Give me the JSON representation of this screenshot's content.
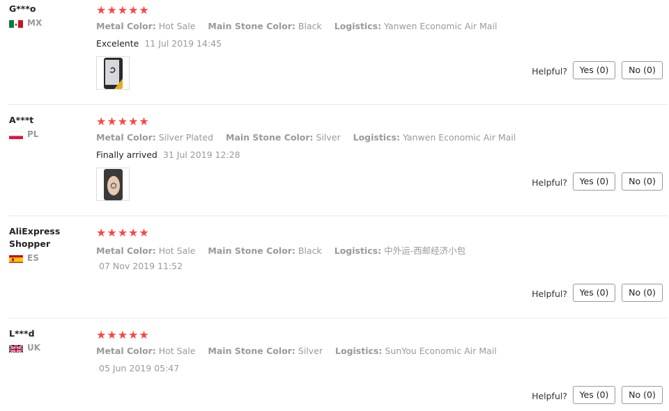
{
  "labels": {
    "metal_color": "Metal Color:",
    "main_stone_color": "Main Stone Color:",
    "logistics": "Logistics:",
    "helpful": "Helpful?",
    "yes": "Yes (0)",
    "no": "No (0)"
  },
  "reviews": [
    {
      "name": "G***o",
      "country": "MX",
      "stars": "★★★★★",
      "rating": 5,
      "metal_color": "Hot Sale",
      "main_stone_color": "Black",
      "logistics": "Yanwen Economic Air Mail",
      "text": "Excelente",
      "date": "11 Jul 2019 14:45",
      "has_photo": true
    },
    {
      "name": "A***t",
      "country": "PL",
      "stars": "★★★★★",
      "rating": 5,
      "metal_color": "Silver Plated",
      "main_stone_color": "Silver",
      "logistics": "Yanwen Economic Air Mail",
      "text": "Finally arrived",
      "date": "31 Jul 2019 12:28",
      "has_photo": true
    },
    {
      "name": "AliExpress Shopper",
      "country": "ES",
      "stars": "★★★★★",
      "rating": 5,
      "metal_color": "Hot Sale",
      "main_stone_color": "Black",
      "logistics": "中外运-西邮经济小包",
      "text": "",
      "date": "07 Nov 2019 11:52",
      "has_photo": false
    },
    {
      "name": "L***d",
      "country": "UK",
      "stars": "★★★★★",
      "rating": 5,
      "metal_color": "Hot Sale",
      "main_stone_color": "Silver",
      "logistics": "SunYou Economic Air Mail",
      "text": "",
      "date": "05 Jun 2019 05:47",
      "has_photo": false
    }
  ],
  "colors": {
    "star": "#ff4747",
    "muted": "#999999",
    "divider": "#e8e8e8"
  }
}
